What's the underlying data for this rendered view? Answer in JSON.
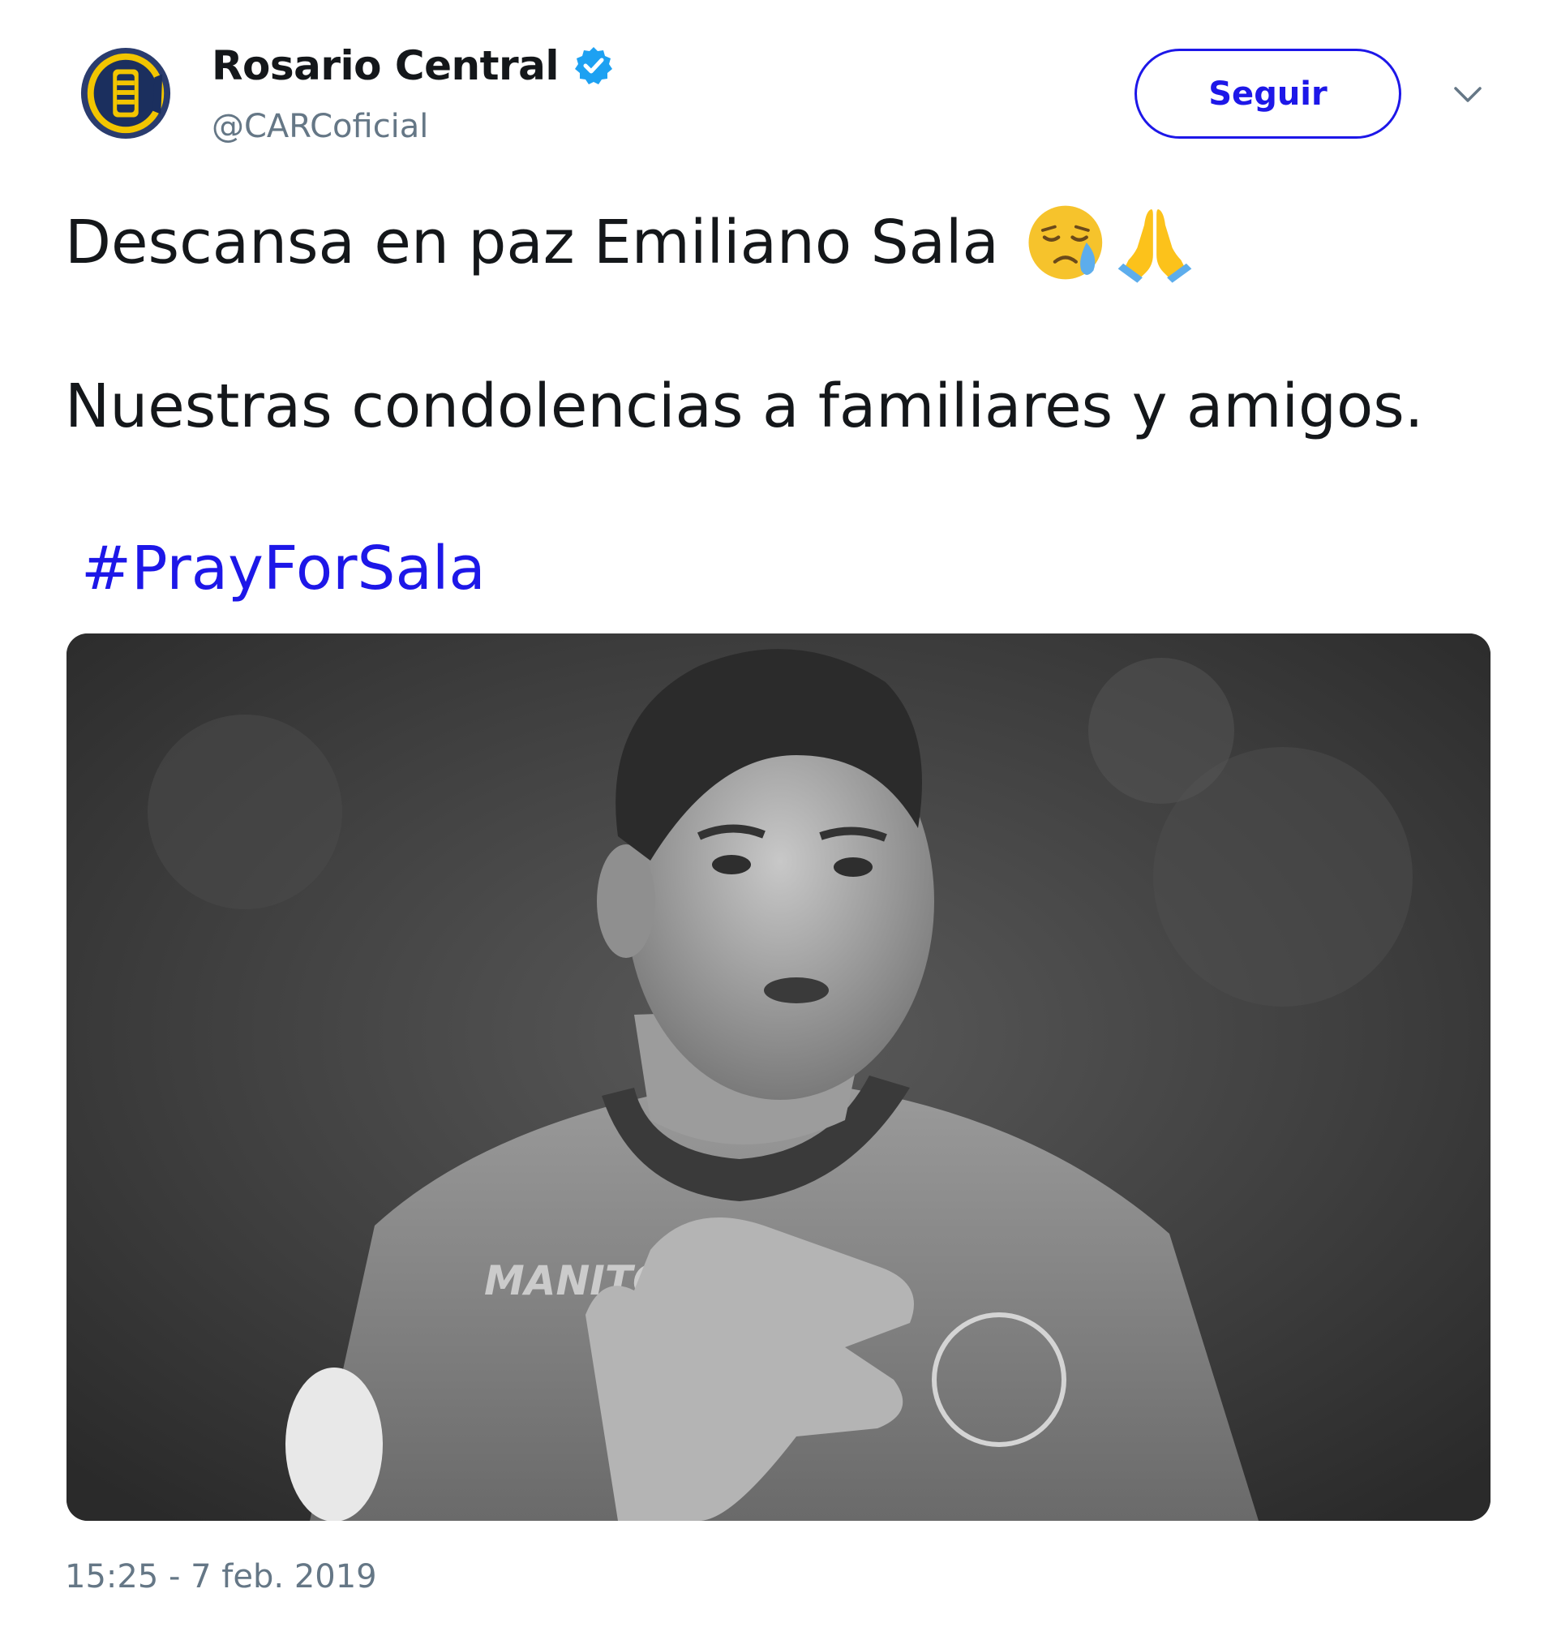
{
  "account": {
    "display_name": "Rosario Central",
    "handle": "@CARCoficial",
    "avatar_icon": "club-crest-icon",
    "verified_icon": "verified-badge-icon"
  },
  "actions": {
    "follow_label": "Seguir",
    "menu_icon": "chevron-down-icon"
  },
  "tweet": {
    "line1": "Descansa en paz Emiliano Sala",
    "emojis": [
      "crying-face-emoji",
      "folded-hands-emoji"
    ],
    "line2": "Nuestras condolencias a familiares y amigos.",
    "hashtag": "#PrayForSala",
    "media_icon": "player-photo"
  },
  "timestamp": "15:25 - 7 feb. 2019",
  "colors": {
    "link_blue": "#1d17e8",
    "verified_blue": "#1da1f2",
    "secondary_text": "#657786",
    "crest_gold": "#f2c500",
    "crest_navy": "#1b2f5e"
  }
}
